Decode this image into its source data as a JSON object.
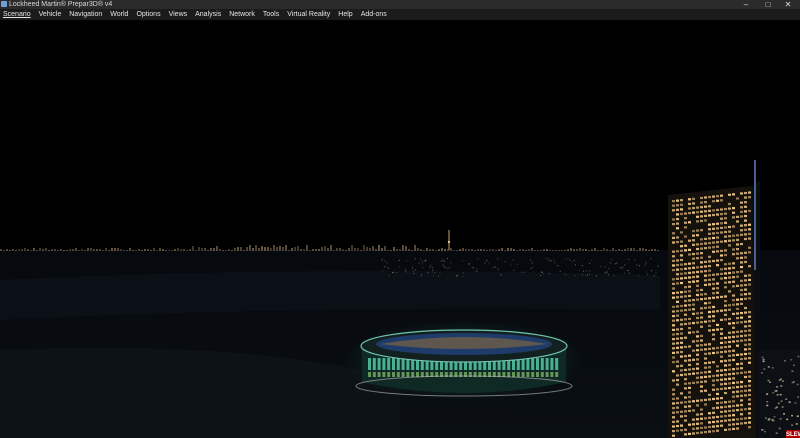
{
  "window": {
    "title": "Lockheed Martin® Prepar3D® v4",
    "controls": {
      "minimize": "–",
      "maximize": "□",
      "close": "✕"
    }
  },
  "menu": {
    "items": [
      {
        "label": "Scenario"
      },
      {
        "label": "Vehicle"
      },
      {
        "label": "Navigation"
      },
      {
        "label": "World"
      },
      {
        "label": "Options"
      },
      {
        "label": "Views"
      },
      {
        "label": "Analysis"
      },
      {
        "label": "Network"
      },
      {
        "label": "Tools"
      },
      {
        "label": "Virtual Reality"
      },
      {
        "label": "Help"
      },
      {
        "label": "Add-ons"
      }
    ]
  },
  "scene": {
    "status_badge": "SLEW",
    "colors": {
      "sky": "#000000",
      "ground": "#05080b",
      "stadium_glow": "#3aa892",
      "tower_windows": "#f2c98a",
      "badge": "#b00000"
    }
  }
}
